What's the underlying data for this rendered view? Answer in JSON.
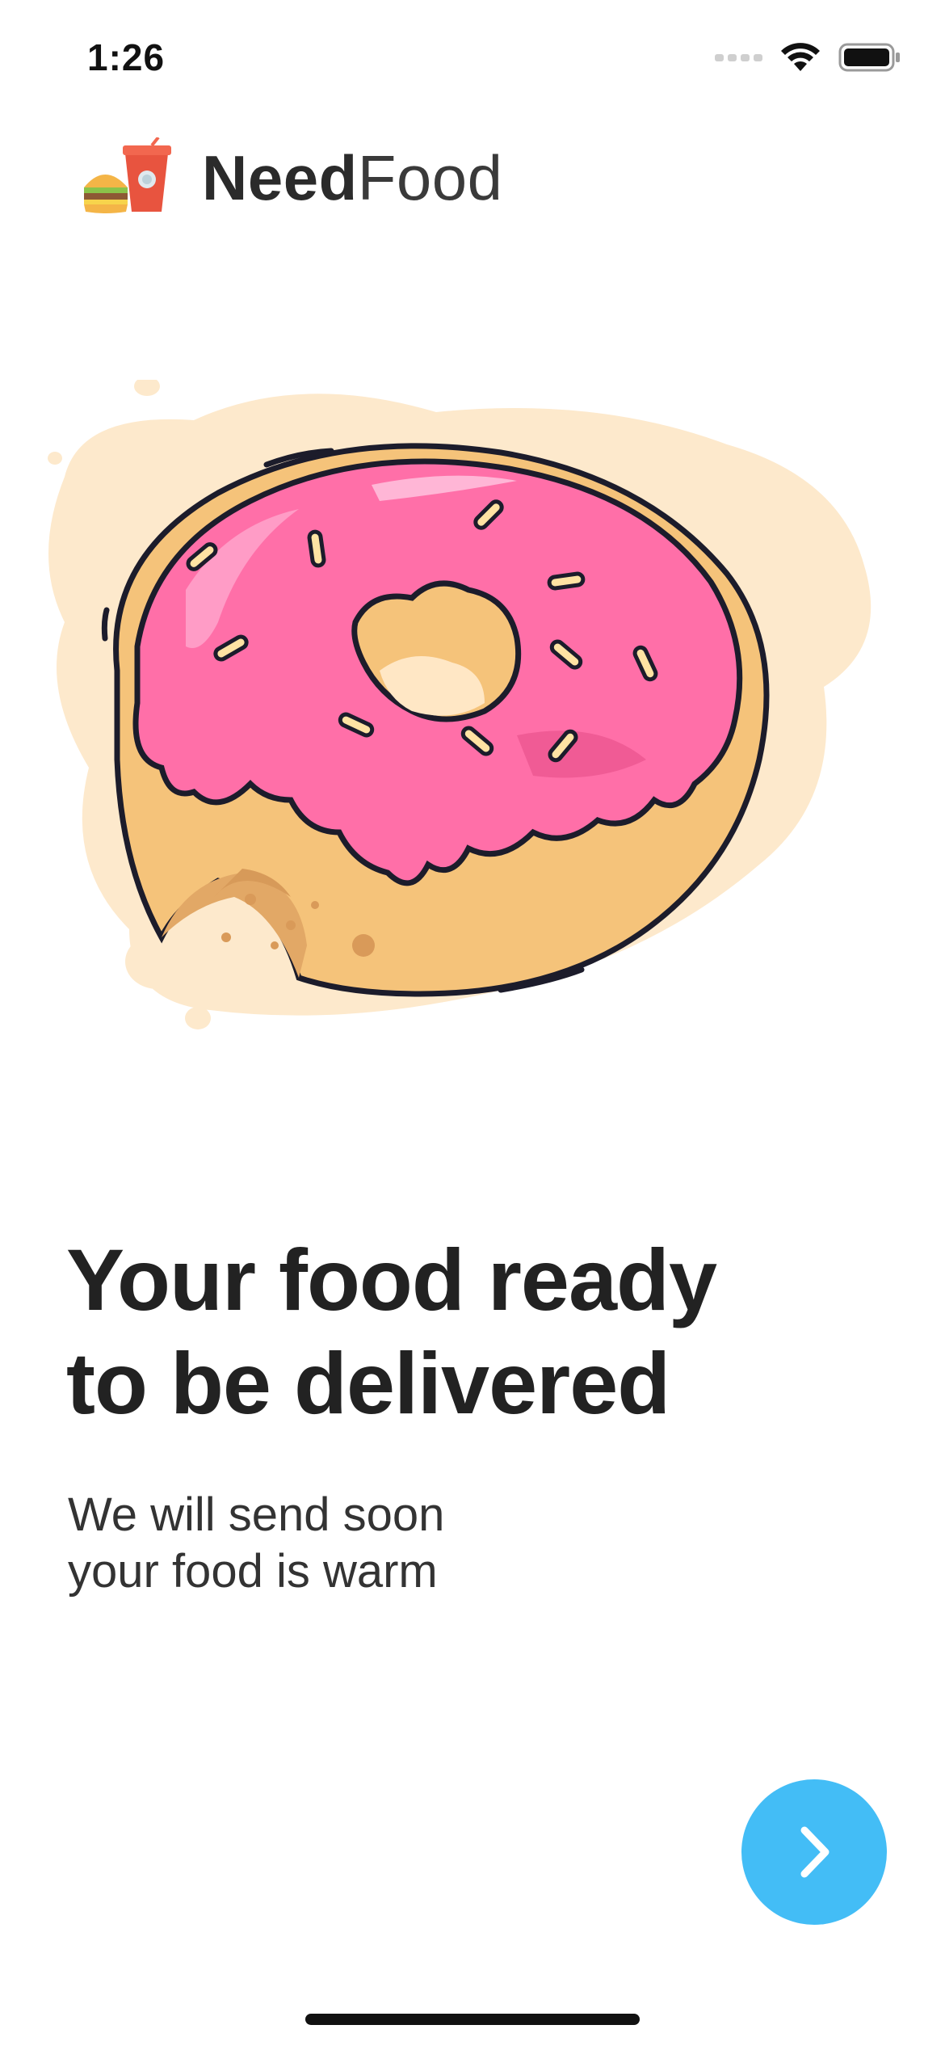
{
  "status_bar": {
    "time": "1:26",
    "icons": [
      "cellular-signal-icon",
      "wifi-icon",
      "battery-icon"
    ]
  },
  "brand": {
    "logo_icon": "burger-and-drink-icon",
    "name_strong": "Need",
    "name_light": "Food"
  },
  "hero": {
    "illustration": "bitten-pink-donut-illustration"
  },
  "onboarding": {
    "headline_line1": "Your food ready",
    "headline_line2": "to be delivered",
    "subtitle_line1": "We will send soon",
    "subtitle_line2": "your food is warm"
  },
  "next_button": {
    "icon": "chevron-right-icon",
    "color": "#43bdf6"
  },
  "colors": {
    "accent": "#43bdf6",
    "frosting": "#ff6fa8",
    "dough": "#f5c37a",
    "blob": "#fde9cc",
    "text_dark": "#222222"
  }
}
